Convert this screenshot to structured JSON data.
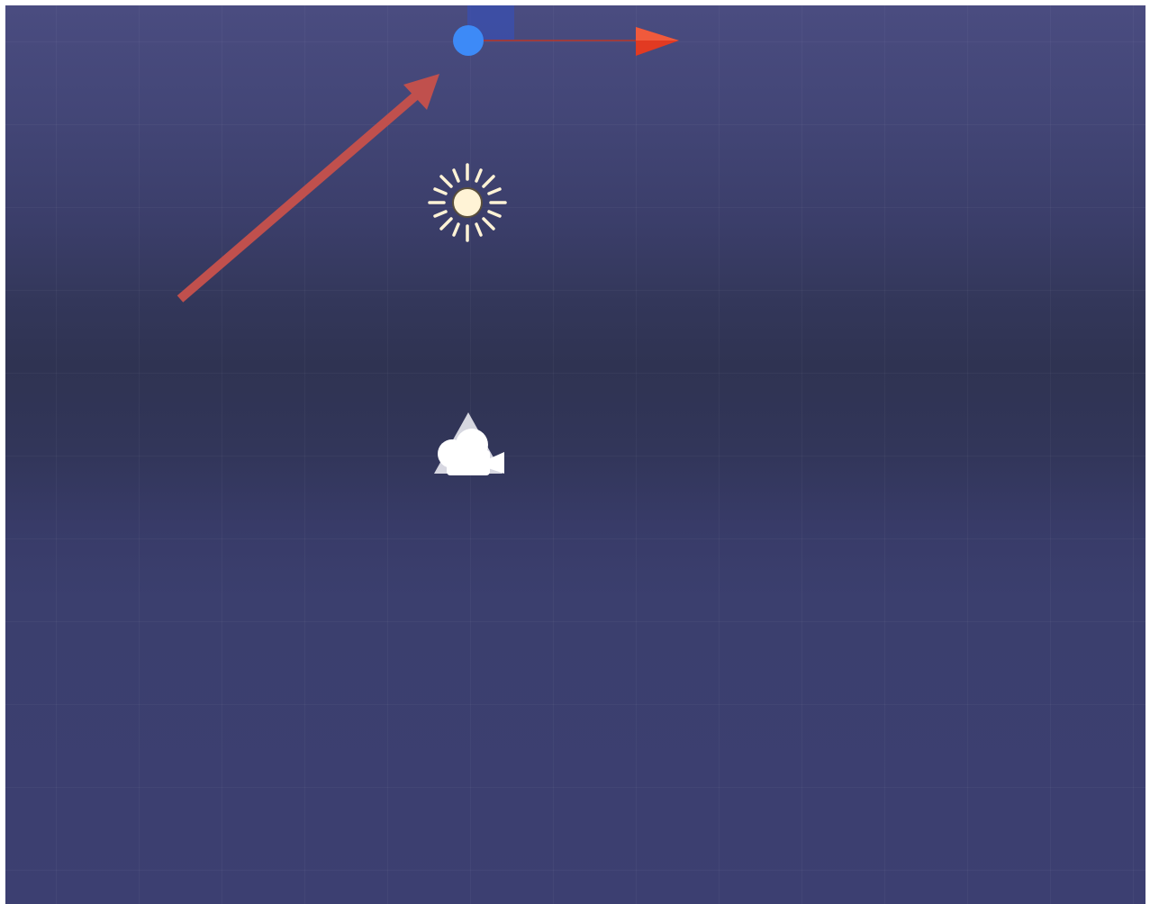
{
  "scene_view": {
    "background_colors": [
      "#4a4c80",
      "#2f3352",
      "#3c3f71"
    ],
    "grid": true
  },
  "gizmo": {
    "pivot_icon": "blue-circle-pivot",
    "pivot_color": "#3d8af7",
    "x_axis_icon": "red-cone-arrow",
    "x_axis_color": "#e23a22",
    "y_plane_color": "#3a4fb0"
  },
  "annotation": {
    "icon": "arrow-pointer",
    "color": "#c0504d"
  },
  "objects": {
    "light_icon": "sun-icon",
    "light_color": "#fff3d6",
    "camera_icon": "camera-icon",
    "camera_color": "#ffffff"
  }
}
